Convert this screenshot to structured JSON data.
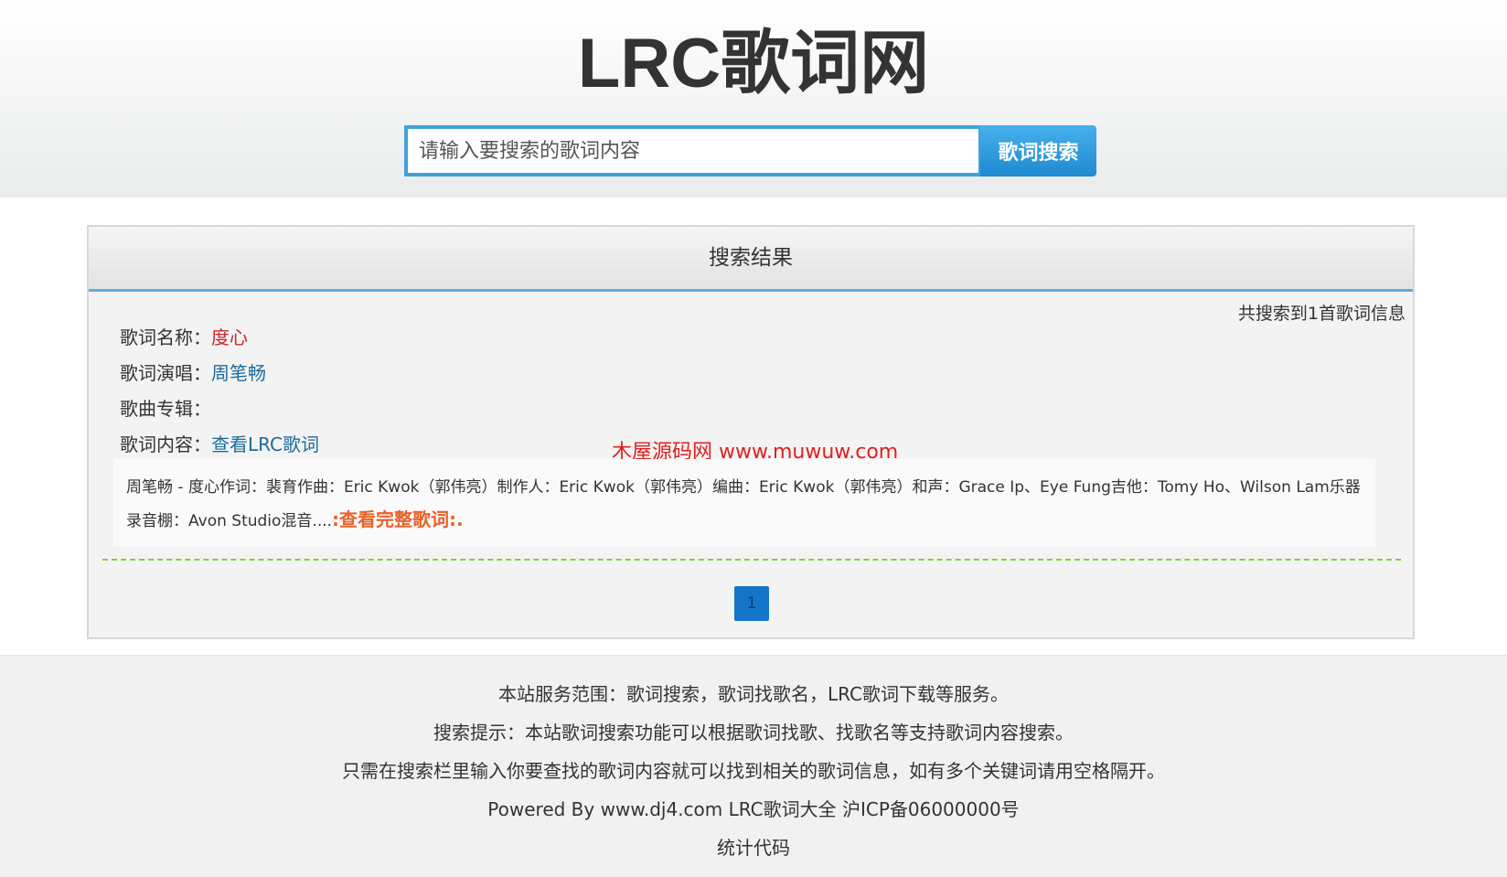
{
  "header": {
    "site_title": "LRC歌词网",
    "search_placeholder": "请输入要搜索的歌词内容",
    "search_button": "歌词搜索"
  },
  "results": {
    "panel_title": "搜索结果",
    "count_text": "共搜索到1首歌词信息",
    "song_name_label": "歌词名称：",
    "song_name": "度心",
    "singer_label": "歌词演唱：",
    "singer": "周笔畅",
    "album_label": "歌曲专辑：",
    "album": "",
    "content_label": "歌词内容：",
    "content_link": "查看LRC歌词",
    "watermark": "木屋源码网 www.muwuw.com",
    "snippet": "周笔畅 - 度心作词：裴育作曲：Eric Kwok（郭伟亮）制作人：Eric Kwok（郭伟亮）编曲：Eric Kwok（郭伟亮）和声：Grace Ip、Eye Fung吉他：Tomy Ho、Wilson Lam乐器录音棚：Avon Studio混音....",
    "more_link": ":查看完整歌词:."
  },
  "pagination": {
    "current_page": "1"
  },
  "footer": {
    "line1": "本站服务范围：歌词搜索，歌词找歌名，LRC歌词下载等服务。",
    "line2": "搜索提示：本站歌词搜索功能可以根据歌词找歌、找歌名等支持歌词内容搜索。",
    "line3": "只需在搜索栏里输入你要查找的歌词内容就可以找到相关的歌词信息，如有多个关键词请用空格隔开。",
    "line4": "Powered By www.dj4.com LRC歌词大全 沪ICP备06000000号",
    "line5": "统计代码"
  },
  "colors": {
    "accent_blue": "#3fa3d8",
    "song_name_red": "#c62828",
    "link_blue": "#1e6b9c",
    "more_link_orange": "#e8622a",
    "separator_green": "#7cd23e"
  }
}
